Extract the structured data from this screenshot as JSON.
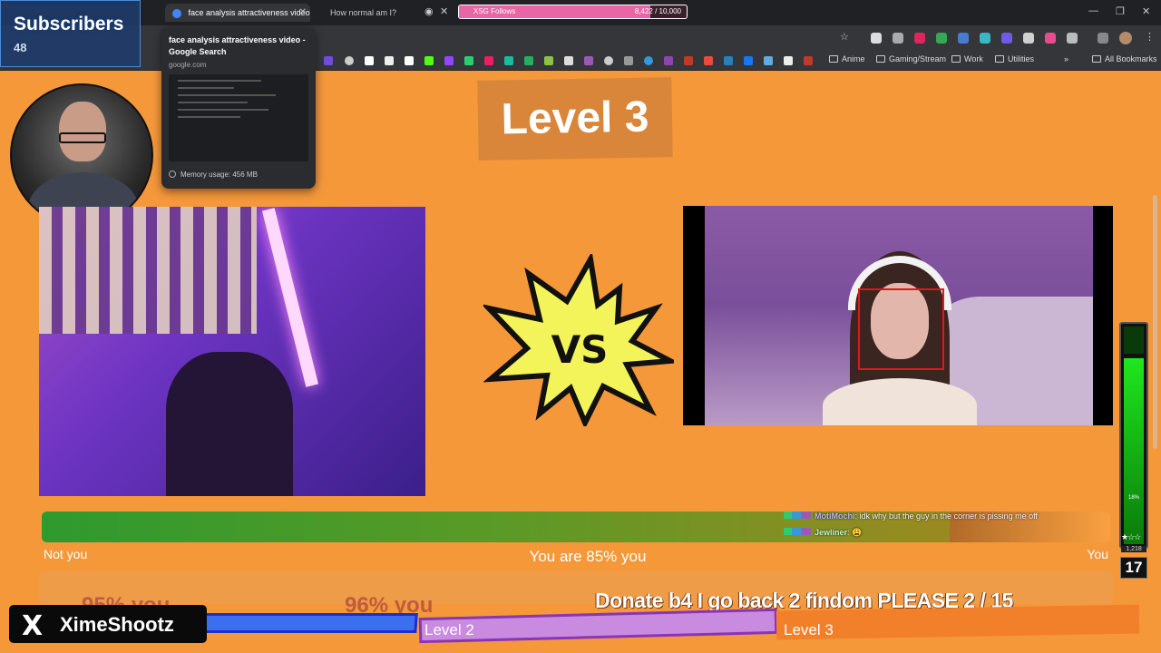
{
  "browser": {
    "tabs": [
      {
        "title": "face analysis attractiveness video",
        "active": true
      },
      {
        "title": "How normal am I?",
        "active": false
      }
    ],
    "xsg_follows": {
      "label": "XSG Follows",
      "count": "8,422 / 10,000",
      "progress": 0.842
    },
    "bookmarks": {
      "folders": [
        "Anime",
        "Gaming/Stream",
        "Work",
        "Utilities",
        "All Bookmarks"
      ],
      "overflow": "»"
    },
    "hover_card": {
      "title": "face analysis attractiveness video - Google Search",
      "domain": "google.com",
      "memory": "Memory usage: 456 MB"
    }
  },
  "overlay": {
    "subscribers": {
      "title": "Subscribers",
      "count": "48"
    },
    "level_title": "Level 3",
    "vs_text": "VS",
    "meter": {
      "left_label": "Not you",
      "center_label": "You are 85% you",
      "right_label": "You",
      "value_pct": 85
    },
    "chat": [
      {
        "user": "MotiMochi",
        "message": ": idk why but the guy in the corner is pissing me off"
      },
      {
        "user": "Jewliner",
        "message": ": 😩"
      }
    ],
    "ghost_texts": [
      "95% you",
      "96% you"
    ],
    "donate_banner": "Donate b4 I go back 2 findom PLEASE 2 / 15",
    "levels": [
      "Level 2",
      "Level 3"
    ],
    "x_handle": {
      "logo": "X",
      "name": "XimeShootz"
    },
    "side_meter": {
      "percent": "18%",
      "fill": 0.18,
      "stars": "★☆☆",
      "count": "1,218",
      "level": "17"
    }
  },
  "colors": {
    "background": "#f5983a",
    "meter_green": "#2e9a2e",
    "face_box": "#e01818",
    "vs_star": "#f3f35a"
  }
}
